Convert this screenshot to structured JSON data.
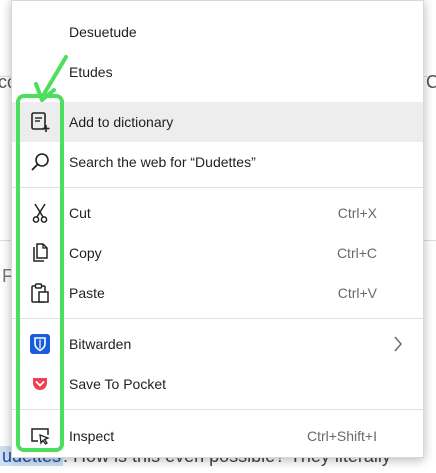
{
  "background": {
    "left_frag_1": "co",
    "right_frag_1": "C",
    "left_frag_2": "Fi",
    "selected_word": "udettes",
    "bottom_text": ". How is this even possible? They literally"
  },
  "menu": {
    "spelling": [
      {
        "label": "Desuetude"
      },
      {
        "label": "Etudes"
      }
    ],
    "add_to_dictionary": {
      "label": "Add to dictionary",
      "icon": "dictionary-add-icon"
    },
    "search_web": {
      "label": "Search the web for “Dudettes”",
      "icon": "search-icon"
    },
    "cut": {
      "label": "Cut",
      "shortcut": "Ctrl+X",
      "icon": "scissors-icon"
    },
    "copy": {
      "label": "Copy",
      "shortcut": "Ctrl+C",
      "icon": "copy-icon"
    },
    "paste": {
      "label": "Paste",
      "shortcut": "Ctrl+V",
      "icon": "paste-icon"
    },
    "bitwarden": {
      "label": "Bitwarden",
      "icon": "bitwarden-shield-icon",
      "submenu_icon": "chevron-right-icon"
    },
    "pocket": {
      "label": "Save To Pocket",
      "icon": "pocket-icon"
    },
    "inspect": {
      "label": "Inspect",
      "shortcut": "Ctrl+Shift+I",
      "icon": "inspect-icon"
    }
  },
  "colors": {
    "highlight_annotation": "#4cde5e",
    "hover_bg": "#ededed",
    "bitwarden_blue": "#175ddc",
    "pocket_red": "#ef4056"
  }
}
